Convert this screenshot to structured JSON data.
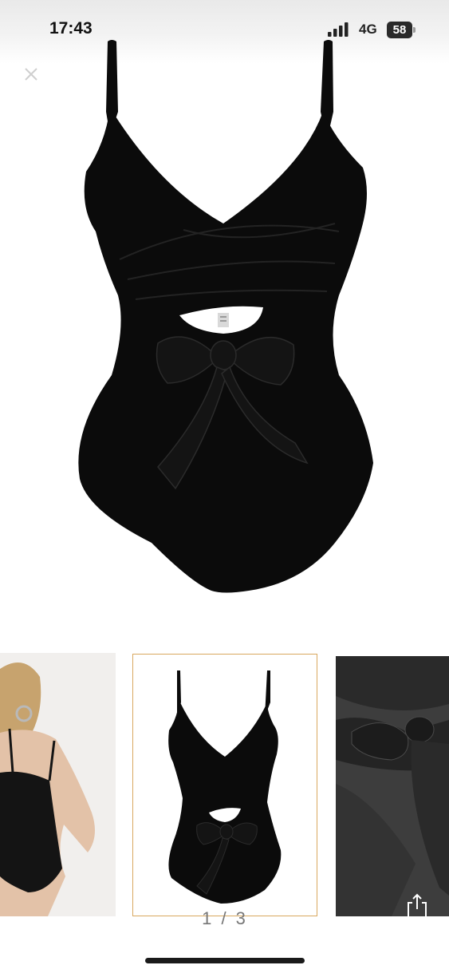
{
  "status_bar": {
    "time": "17:43",
    "network": "4G",
    "battery": "58",
    "icons": [
      "signal-bars-icon",
      "battery-icon"
    ]
  },
  "viewer": {
    "close_icon": "close-icon",
    "main_image_alt": "Black one-piece wrap swimsuit with front bow",
    "thumbnails": [
      {
        "name": "back-view"
      },
      {
        "name": "front-view"
      },
      {
        "name": "bow-detail"
      }
    ],
    "page_indicator": "1 / 3",
    "share_icon": "share-icon"
  },
  "colors": {
    "swimsuit": "#0b0b0b",
    "selected_border": "#d9a85f",
    "background": "#ffffff"
  }
}
